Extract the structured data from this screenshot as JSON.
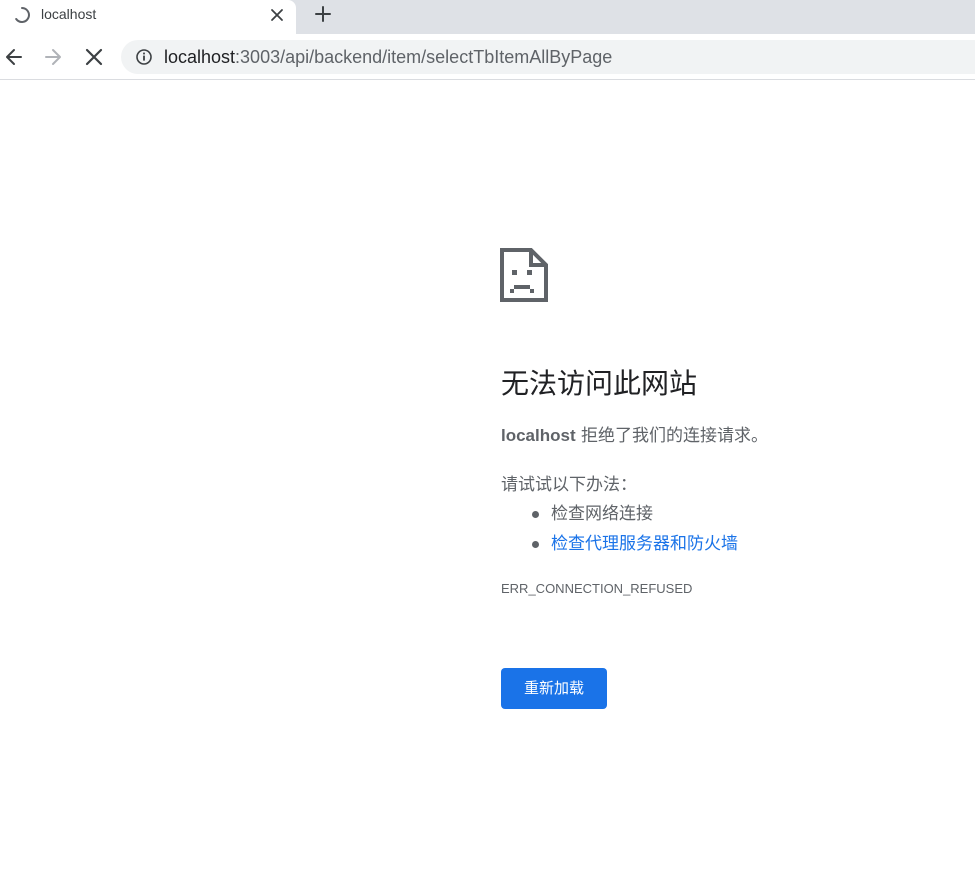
{
  "browser": {
    "tab": {
      "title": "localhost",
      "loading_icon": "loading-spinner-icon",
      "close_icon": "close-icon"
    },
    "new_tab_icon": "plus-icon",
    "toolbar": {
      "back_icon": "arrow-back-icon",
      "forward_icon": "arrow-forward-icon",
      "stop_icon": "stop-loading-icon",
      "site_info_icon": "info-icon",
      "url_host": "localhost",
      "url_rest": ":3003/api/backend/item/selectTbItemAllByPage"
    }
  },
  "error_page": {
    "icon": "sad-document-icon",
    "title": "无法访问此网站",
    "host": "localhost",
    "description_suffix": " 拒绝了我们的连接请求。",
    "suggestions_heading": "请试试以下办法：",
    "suggestions": [
      {
        "label": "检查网络连接",
        "is_link": false
      },
      {
        "label": "检查代理服务器和防火墙",
        "is_link": true
      }
    ],
    "error_code": "ERR_CONNECTION_REFUSED",
    "reload_label": "重新加载"
  },
  "colors": {
    "accent": "#1a73e8",
    "text_primary": "#202124",
    "text_secondary": "#5f6368",
    "tabstrip_bg": "#dee1e6",
    "omnibox_bg": "#f1f3f4"
  }
}
